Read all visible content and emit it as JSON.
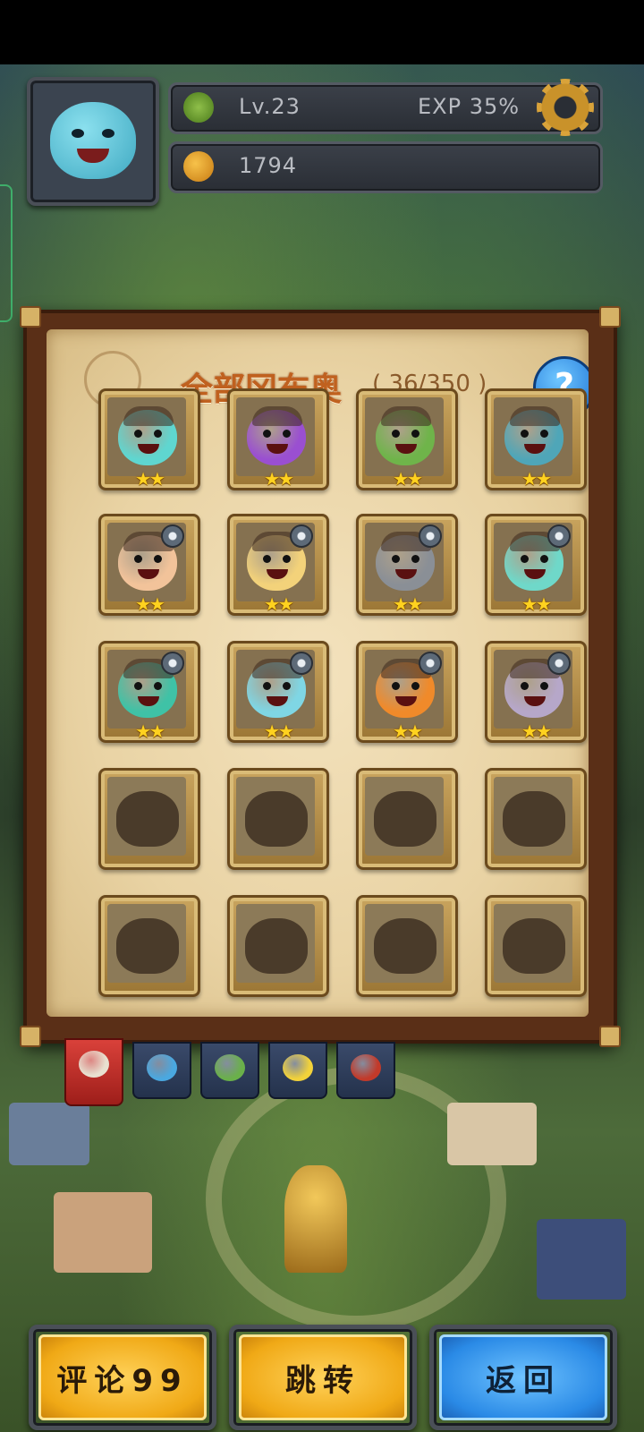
{
  "header": {
    "level": "Lv.23",
    "exp": "EXP 35%",
    "currency": "1794"
  },
  "codex": {
    "title": "全部冈布奥",
    "count": "( 36/350 )",
    "help_label": "?",
    "rows": [
      {
        "partial": true,
        "slots": [
          {
            "state": "owned",
            "stars": "★★",
            "color": "#5fd6d0"
          },
          {
            "state": "owned",
            "stars": "★★",
            "color": "#9a4fd1"
          },
          {
            "state": "owned",
            "stars": "★★",
            "color": "#6fb44a"
          },
          {
            "state": "owned",
            "stars": "★★",
            "color": "#4fa6b8"
          }
        ]
      },
      {
        "slots": [
          {
            "state": "owned",
            "stars": "★★",
            "color": "#f2c39a"
          },
          {
            "state": "owned",
            "stars": "★★",
            "color": "#f3d27a"
          },
          {
            "state": "owned",
            "stars": "★★",
            "color": "#8a8f96"
          },
          {
            "state": "owned",
            "stars": "★★",
            "color": "#6fd8c9"
          }
        ]
      },
      {
        "slots": [
          {
            "state": "owned",
            "stars": "★★",
            "color": "#3fc2a6"
          },
          {
            "state": "owned",
            "stars": "★★",
            "color": "#7fd6e4"
          },
          {
            "state": "owned",
            "stars": "★★",
            "color": "#f08a2a"
          },
          {
            "state": "owned",
            "stars": "★★",
            "color": "#b6a7c9"
          }
        ]
      },
      {
        "slots": [
          {
            "state": "locked"
          },
          {
            "state": "locked"
          },
          {
            "state": "locked"
          },
          {
            "state": "locked"
          }
        ]
      },
      {
        "slots": [
          {
            "state": "locked"
          },
          {
            "state": "locked"
          },
          {
            "state": "locked"
          },
          {
            "state": "locked"
          }
        ]
      }
    ]
  },
  "tabs": [
    {
      "name": "all",
      "color": "#e8e0d0",
      "active": true
    },
    {
      "name": "blue",
      "color": "#4aa8e0",
      "active": false
    },
    {
      "name": "green",
      "color": "#6ab04a",
      "active": false
    },
    {
      "name": "yellow",
      "color": "#f2d23a",
      "active": false
    },
    {
      "name": "red",
      "color": "#c23a2a",
      "active": false
    }
  ],
  "buttons": {
    "comment": "评论99",
    "jump": "跳转",
    "back": "返回"
  },
  "colors": {
    "title": "#c0611f",
    "button_yellow": "#f0a916",
    "button_blue": "#2a8ae6"
  }
}
